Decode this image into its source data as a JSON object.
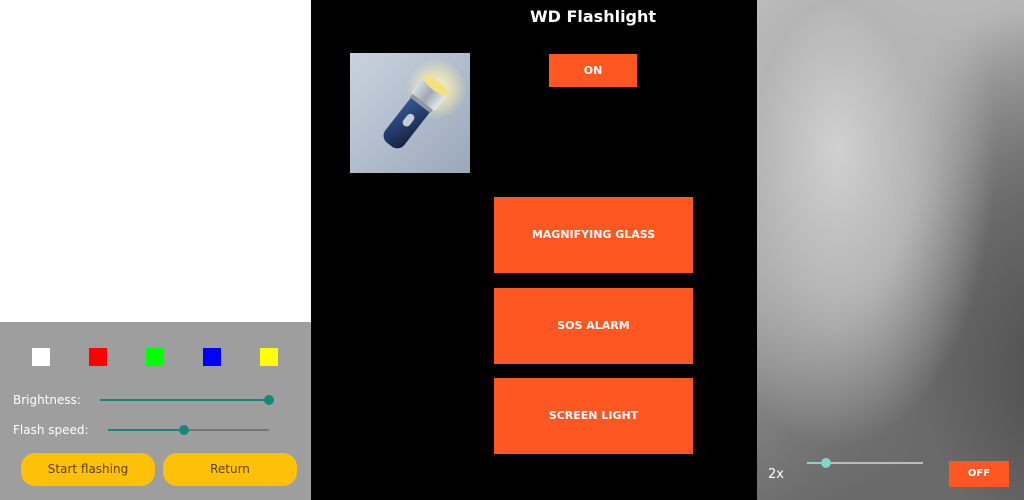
{
  "screen_light": {
    "colors": [
      {
        "name": "white",
        "hex": "#ffffff"
      },
      {
        "name": "red",
        "hex": "#ff0000"
      },
      {
        "name": "green",
        "hex": "#00ff00"
      },
      {
        "name": "blue",
        "hex": "#0000ff"
      },
      {
        "name": "yellow",
        "hex": "#ffff00"
      }
    ],
    "brightness_label": "Brightness:",
    "brightness_value": 1.0,
    "flash_speed_label": "Flash speed:",
    "flash_speed_value": 0.47,
    "start_button": "Start flashing",
    "return_button": "Return",
    "accent_color": "#13897a",
    "button_color": "#ffc107"
  },
  "main": {
    "title": "WD Flashlight",
    "app_icon": "flashlight-icon",
    "on_button": "ON",
    "buttons": [
      "MAGNIFYING GLASS",
      "SOS ALARM",
      "SCREEN LIGHT"
    ],
    "button_color": "#ff5722"
  },
  "magnifier": {
    "zoom_label": "2x",
    "zoom_value": 0.16,
    "off_button": "OFF"
  }
}
